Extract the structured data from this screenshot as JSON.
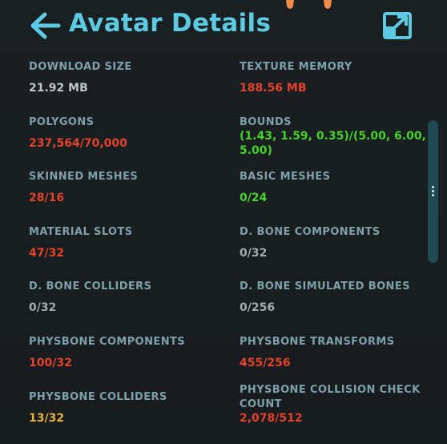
{
  "header": {
    "title": "Avatar Details",
    "back_icon": "arrow-left-icon",
    "popout_icon": "open-in-new-window-icon"
  },
  "colors": {
    "accent": "#5ccbe2",
    "label": "#7ea0a8",
    "neutral": "#bfc7c9",
    "muted": "#a3abad",
    "bad": "#e2432a",
    "good": "#44d22c",
    "warn": "#e6b23e",
    "background": "#171c1f"
  },
  "stats": {
    "download_size": {
      "label": "DOWNLOAD SIZE",
      "value": "21.92 MB"
    },
    "texture_memory": {
      "label": "TEXTURE MEMORY",
      "value": "188.56 MB"
    },
    "polygons": {
      "label": "POLYGONS",
      "value": "237,564/70,000"
    },
    "bounds": {
      "label": "BOUNDS",
      "value_line1": "(1.43, 1.59, 0.35)/(5.00, 6.00,",
      "value_line2": "5.00)"
    },
    "skinned_meshes": {
      "label": "SKINNED MESHES",
      "value": "28/16"
    },
    "basic_meshes": {
      "label": "BASIC MESHES",
      "value": "0/24"
    },
    "material_slots": {
      "label": "MATERIAL SLOTS",
      "value": "47/32"
    },
    "d_bone_components": {
      "label": "D. BONE COMPONENTS",
      "value": "0/32"
    },
    "d_bone_colliders": {
      "label": "D. BONE COLLIDERS",
      "value": "0/32"
    },
    "d_bone_simulated_bones": {
      "label": "D. BONE SIMULATED BONES",
      "value": "0/256"
    },
    "physbone_components": {
      "label": "PHYSBONE COMPONENTS",
      "value": "100/32"
    },
    "physbone_transforms": {
      "label": "PHYSBONE TRANSFORMS",
      "value": "455/256"
    },
    "physbone_colliders": {
      "label": "PHYSBONE COLLIDERS",
      "value": "13/32"
    },
    "physbone_collision_check_count": {
      "label_line1": "PHYSBONE COLLISION CHECK",
      "label_line2": "COUNT",
      "value": "2,078/512"
    }
  }
}
